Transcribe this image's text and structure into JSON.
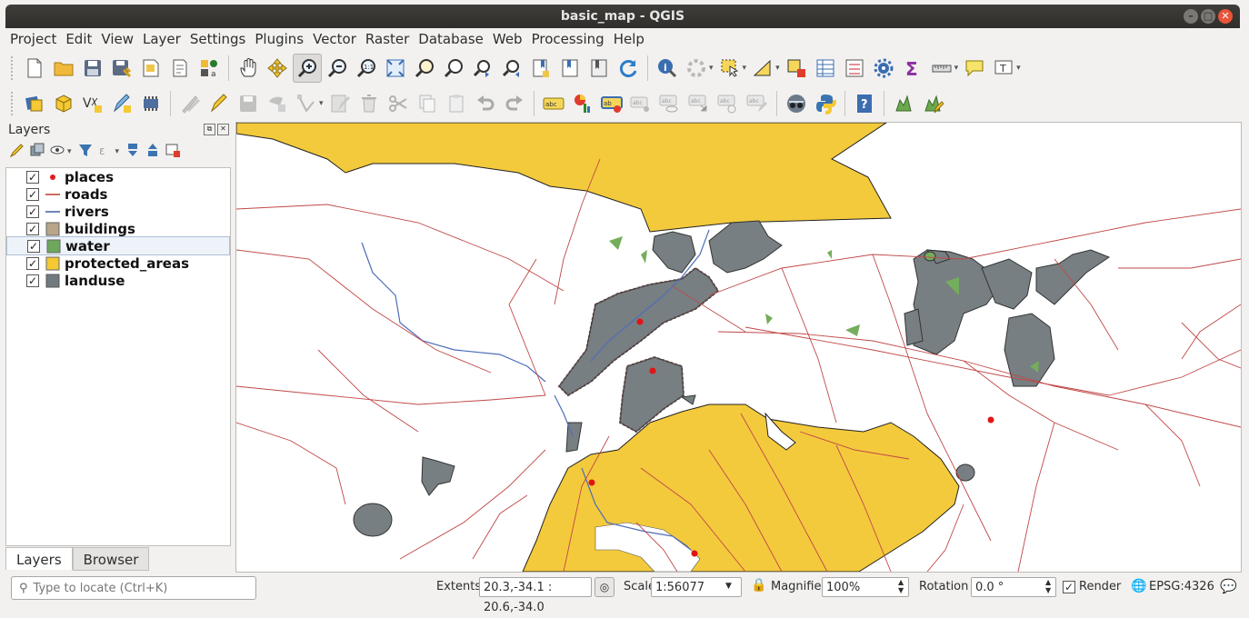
{
  "window": {
    "title": "basic_map - QGIS"
  },
  "menubar": {
    "items": [
      "Project",
      "Edit",
      "View",
      "Layer",
      "Settings",
      "Plugins",
      "Vector",
      "Raster",
      "Database",
      "Web",
      "Processing",
      "Help"
    ]
  },
  "toolbar1": {
    "icons": [
      "new-project-icon",
      "open-project-icon",
      "save-project-icon",
      "save-as-icon",
      "print-layout-icon",
      "layout-manager-icon",
      "style-manager-icon",
      "pan-icon",
      "pan-to-selection-icon",
      "zoom-in-icon",
      "zoom-out-icon",
      "zoom-native-icon",
      "zoom-full-icon",
      "zoom-to-selection-icon",
      "zoom-to-layer-icon",
      "zoom-last-icon",
      "zoom-next-icon",
      "new-bookmark-icon",
      "show-bookmarks-icon",
      "map-tips-icon",
      "refresh-icon",
      "identify-icon",
      "run-action-icon",
      "select-features-icon",
      "select-by-value-icon",
      "deselect-icon",
      "attribute-table-icon",
      "field-calculator-icon",
      "toolbox-icon",
      "statistics-icon",
      "measure-icon",
      "annotation-icon",
      "text-annotation-icon"
    ]
  },
  "toolbar2": {
    "icons": [
      "data-source-manager-icon",
      "new-geopackage-icon",
      "new-shapefile-icon",
      "digitize-icon",
      "new-temp-layer-icon",
      "current-edits-icon",
      "toggle-editing-icon",
      "save-edits-icon",
      "add-feature-icon",
      "vertex-tool-icon",
      "modify-attributes-icon",
      "delete-selected-icon",
      "cut-features-icon",
      "copy-features-icon",
      "paste-features-icon",
      "undo-icon",
      "redo-icon",
      "label-tool-icon",
      "diagram-tool-icon",
      "highlight-labels-icon",
      "pin-labels-icon",
      "show-labels-icon",
      "move-label-icon",
      "rotate-label-icon",
      "change-label-icon",
      "python-icon",
      "help-icon",
      "plugin-icon",
      "plugin-edit-icon"
    ]
  },
  "layers_panel": {
    "title": "Layers",
    "layers": [
      {
        "name": "places",
        "checked": true,
        "symbol": "point",
        "color": "#e31a1c"
      },
      {
        "name": "roads",
        "checked": true,
        "symbol": "line",
        "color": "#c0392b"
      },
      {
        "name": "rivers",
        "checked": true,
        "symbol": "line",
        "color": "#3c5e9e"
      },
      {
        "name": "buildings",
        "checked": true,
        "symbol": "fill",
        "color": "#b8a58a"
      },
      {
        "name": "water",
        "checked": true,
        "symbol": "fill",
        "color": "#6da85c"
      },
      {
        "name": "protected_areas",
        "checked": true,
        "symbol": "fill",
        "color": "#f5c933"
      },
      {
        "name": "landuse",
        "checked": true,
        "symbol": "fill",
        "color": "#717b7f"
      }
    ],
    "tabs": [
      "Layers",
      "Browser"
    ]
  },
  "map_colors": {
    "protected": "#f3ca3c",
    "landuse": "#777f82",
    "buildings": "#5c4647",
    "roads": "#c14747",
    "rivers": "#4e6eb8",
    "water": "#74ad5b",
    "places": "#e01515"
  },
  "statusbar": {
    "locate_placeholder": "Type to locate (Ctrl+K)",
    "extents_label": "Extents:",
    "extents_value": "20.3,-34.1 : 20.6,-34.0",
    "scale_label": "Scale",
    "scale_value": "1:56077",
    "magnifier_label": "Magnifier",
    "magnifier_value": "100%",
    "rotation_label": "Rotation",
    "rotation_value": "0.0 °",
    "render_label": "Render",
    "render_checked": true,
    "crs": "EPSG:4326"
  }
}
